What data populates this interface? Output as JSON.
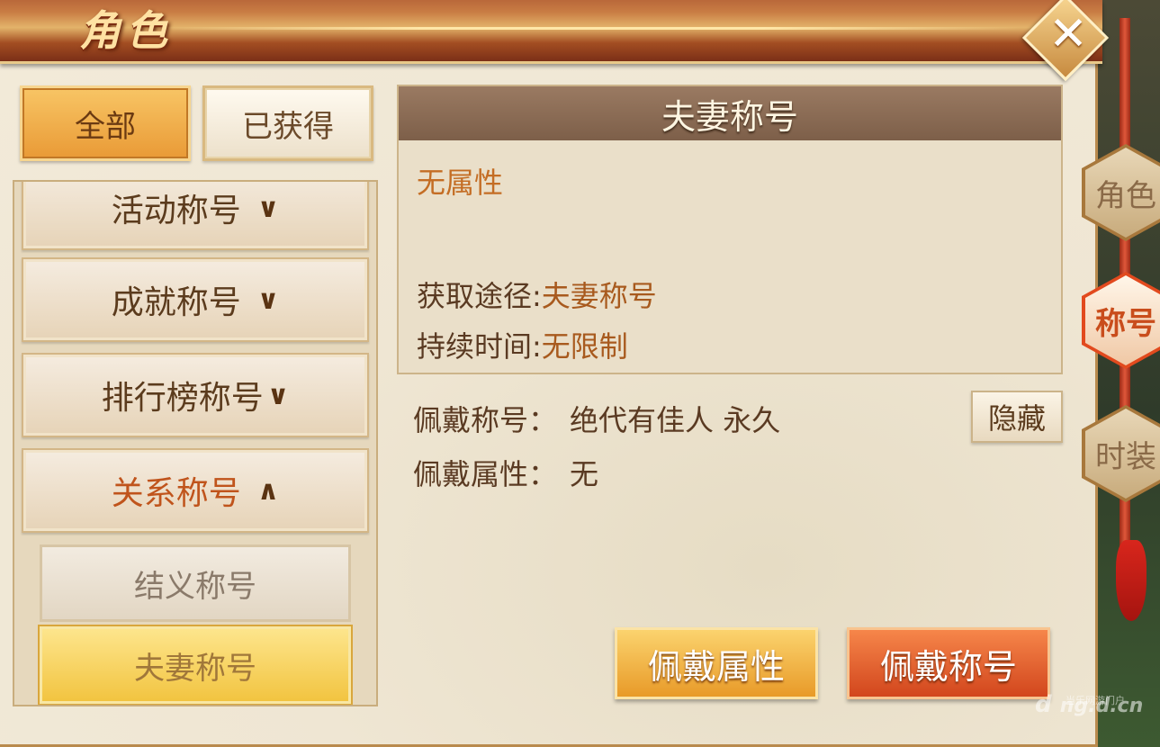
{
  "window": {
    "title": "角色",
    "close_icon": "close-icon"
  },
  "filters": [
    {
      "label": "全部",
      "selected": true
    },
    {
      "label": "已获得",
      "selected": false
    }
  ],
  "categories": [
    {
      "label": "活动称号",
      "expanded": false
    },
    {
      "label": "成就称号",
      "expanded": false
    },
    {
      "label": "排行榜称号",
      "expanded": false
    },
    {
      "label": "关系称号",
      "expanded": true
    }
  ],
  "subcategories": [
    {
      "label": "结义称号",
      "selected": false
    },
    {
      "label": "夫妻称号",
      "selected": true
    }
  ],
  "detail": {
    "header": "夫妻称号",
    "attribute_text": "无属性",
    "source_label": "获取途径:",
    "source_value": "夫妻称号",
    "duration_label": "持续时间:",
    "duration_value": "无限制"
  },
  "wearing": {
    "title_label": "佩戴称号：",
    "title_value": "绝代有佳人 永久",
    "attr_label": "佩戴属性：",
    "attr_value": "无",
    "hide_button": "隐藏"
  },
  "actions": {
    "wear_attr_button": "佩戴属性",
    "wear_title_button": "佩戴称号"
  },
  "side_tabs": [
    {
      "label": "角色",
      "active": false
    },
    {
      "label": "称号",
      "active": true
    },
    {
      "label": "时装",
      "active": false
    }
  ],
  "watermark": {
    "logo": "d",
    "site": "ng.d.cn",
    "caption": "当乐网游门户"
  }
}
